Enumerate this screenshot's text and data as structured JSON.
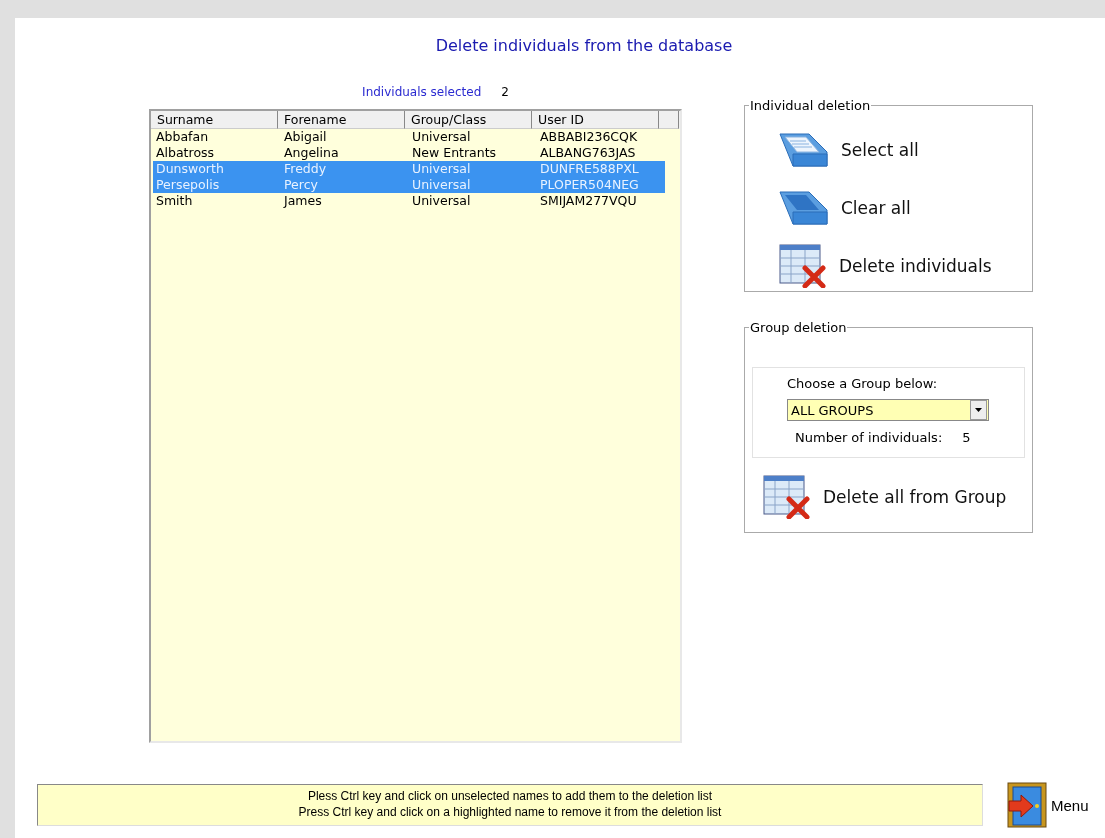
{
  "window": {
    "title": "Delete individuals from the database"
  },
  "selection": {
    "label": "Individuals selected",
    "count": "2"
  },
  "table": {
    "columns": [
      "Surname",
      "Forename",
      "Group/Class",
      "User ID"
    ],
    "rows": [
      {
        "cells": [
          "Abbafan",
          "Abigail",
          "Universal",
          "ABBABI236CQK"
        ],
        "selected": false
      },
      {
        "cells": [
          "Albatross",
          "Angelina",
          "New Entrants",
          "ALBANG763JAS"
        ],
        "selected": false
      },
      {
        "cells": [
          "Dunsworth",
          "Freddy",
          "Universal",
          "DUNFRE588PXL"
        ],
        "selected": true
      },
      {
        "cells": [
          "Persepolis",
          "Percy",
          "Universal",
          "PLOPER504NEG"
        ],
        "selected": true
      },
      {
        "cells": [
          "Smith",
          "James",
          "Universal",
          "SMIJAM277VQU"
        ],
        "selected": false
      }
    ]
  },
  "individual_deletion": {
    "title": "Individual deletion",
    "buttons": [
      {
        "label": "Select all",
        "kind": "full_tray"
      },
      {
        "label": "Clear all",
        "kind": "empty_tray"
      },
      {
        "label": "Delete individuals",
        "kind": "delete_table"
      }
    ]
  },
  "group_deletion": {
    "title": "Group deletion",
    "prompt": "Choose a Group below:",
    "dropdown": {
      "value": "ALL GROUPS"
    },
    "count_label": "Number of individuals:",
    "count": "5",
    "button": {
      "label": "Delete all from Group",
      "kind": "delete_table"
    }
  },
  "help": [
    "Pless Ctrl key and click on unselected names to add them to the deletion list",
    "Press Ctrl key and click on a highlighted name to remove it from the deletion list"
  ],
  "menu_button": {
    "label": "Menu"
  }
}
